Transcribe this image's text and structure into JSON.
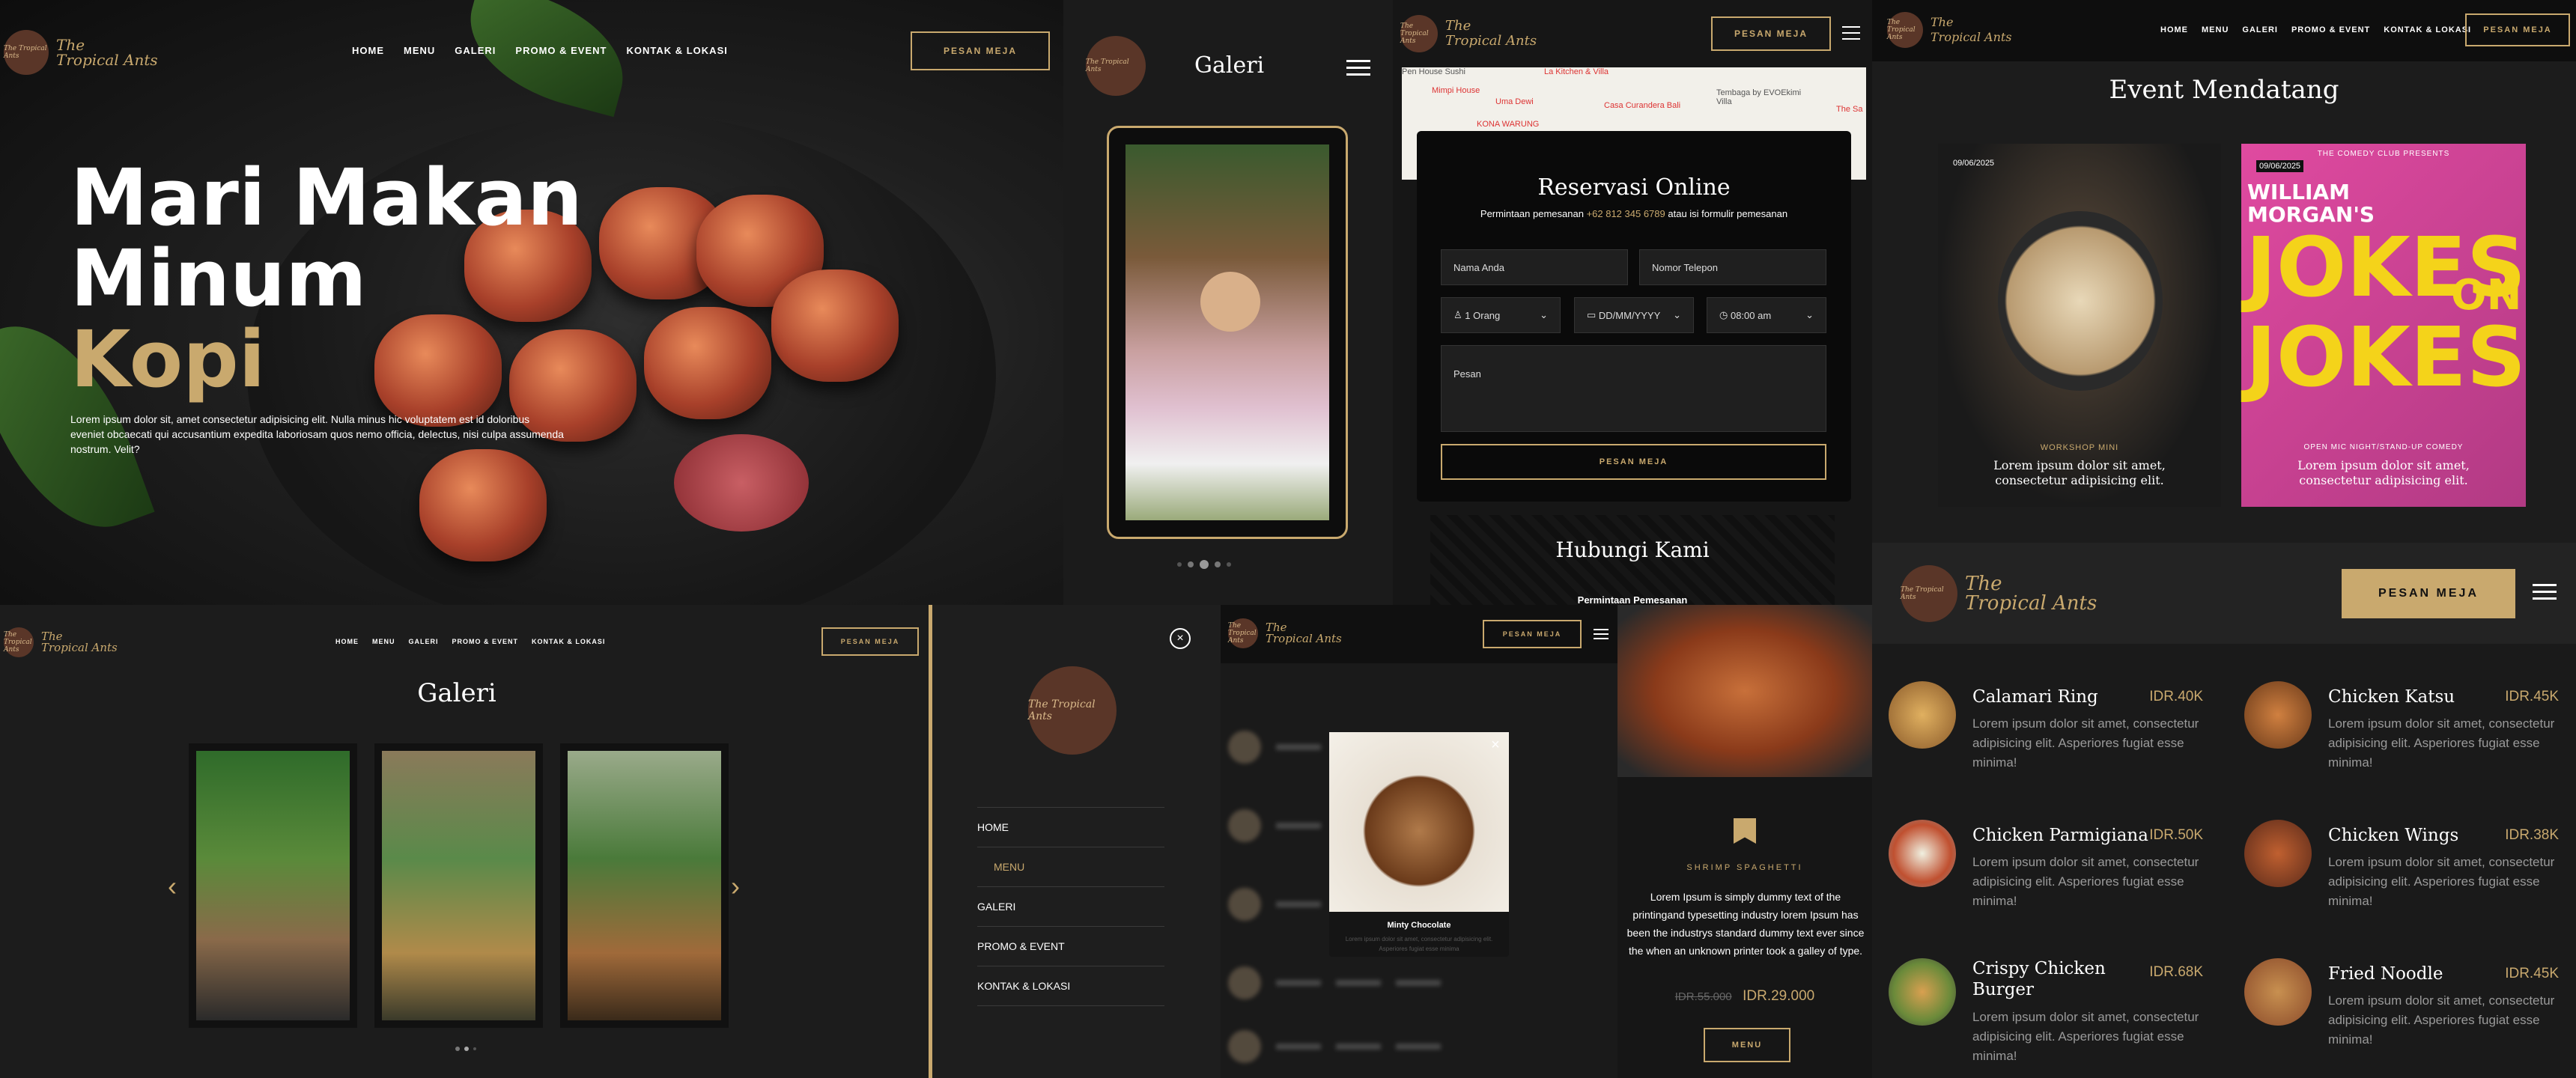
{
  "brand": {
    "logo_badge": "The Tropical Ants",
    "name_line1": "The",
    "name_line2": "Tropical Ants"
  },
  "nav": [
    "HOME",
    "MENU",
    "GALERI",
    "PROMO & EVENT",
    "KONTAK & LOKASI"
  ],
  "cta_label": "PESAN MEJA",
  "hero": {
    "line1": "Mari Makan",
    "line2": "Minum",
    "line3": "Kopi",
    "desc": "Lorem ipsum dolor sit, amet consectetur adipisicing elit. Nulla minus hic voluptatem est id doloribus eveniet obcaecati qui accusantium expedita laboriosam quos nemo officia, delectus, nisi culpa assumenda nostrum. Velit?"
  },
  "gallery_mobile": {
    "title": "Galeri"
  },
  "map_labels": [
    "Pen House Sushi",
    "La Kitchen & Villa",
    "Mimpi House",
    "Uma Dewi",
    "Casa Curandera Bali",
    "Tembaga by EVOEkimi Villa",
    "KONA WARUNG",
    "The Sa"
  ],
  "reservation": {
    "title": "Reservasi Online",
    "subtitle_pre": "Permintaan pemesanan",
    "phone": "+62 812 345 6789",
    "subtitle_post": "atau isi formulir pemesanan",
    "name_ph": "Nama Anda",
    "phone_ph": "Nomor Telepon",
    "people": "1 Orang",
    "date": "DD/MM/YYYY",
    "time": "08:00 am",
    "message_ph": "Pesan",
    "submit": "PESAN MEJA"
  },
  "contact": {
    "title": "Hubungi Kami",
    "sub": "Permintaan Pemesanan"
  },
  "events": {
    "title": "Event Mendatang",
    "items": [
      {
        "date": "09/06/2025",
        "tag": "WORKSHOP MINI",
        "desc": "Lorem ipsum dolor sit amet, consectetur adipisicing elit."
      },
      {
        "date": "09/06/2025",
        "top": "THE COMEDY CLUB PRESENTS",
        "poster1": "WILLIAM",
        "poster2": "MORGAN'S",
        "poster3": "JOKES",
        "poster4": "ON",
        "poster5": "JOKES",
        "tag": "OPEN MIC NIGHT/STAND-UP COMEDY",
        "desc": "Lorem ipsum dolor sit amet, consectetur adipisicing elit."
      }
    ]
  },
  "menu_list": [
    {
      "name": "Calamari Ring",
      "price": "IDR.40K",
      "desc": "Lorem ipsum dolor sit amet, consectetur adipisicing elit. Asperiores fugiat esse minima!"
    },
    {
      "name": "Chicken Katsu",
      "price": "IDR.45K",
      "desc": "Lorem ipsum dolor sit amet, consectetur adipisicing elit. Asperiores fugiat esse minima!"
    },
    {
      "name": "Chicken Parmigiana",
      "price": "IDR.50K",
      "desc": "Lorem ipsum dolor sit amet, consectetur adipisicing elit. Asperiores fugiat esse minima!"
    },
    {
      "name": "Chicken Wings",
      "price": "IDR.38K",
      "desc": "Lorem ipsum dolor sit amet, consectetur adipisicing elit. Asperiores fugiat esse minima!"
    },
    {
      "name": "Crispy Chicken Burger",
      "price": "IDR.68K",
      "desc": "Lorem ipsum dolor sit amet, consectetur adipisicing elit. Asperiores fugiat esse minima!"
    },
    {
      "name": "Fried Noodle",
      "price": "IDR.45K",
      "desc": "Lorem ipsum dolor sit amet, consectetur adipisicing elit. Asperiores fugiat esse minima!"
    }
  ],
  "gallery_desktop": {
    "title": "Galeri"
  },
  "mobile_menu": [
    "HOME",
    "MENU",
    "GALERI",
    "PROMO & EVENT",
    "KONTAK & LOKASI"
  ],
  "popup": {
    "title": "Minty Chocolate",
    "desc1": "Lorem ipsum dolor sit amet, consectetur adipisicing elit.",
    "desc2": "Asperiores fugiat esse minima"
  },
  "dish": {
    "title": "SHRIMP SPAGHETTI",
    "desc": "Lorem Ipsum is simply dummy text of the printingand typesetting industry lorem Ipsum has been the industrys standard dummy text ever since the when an unknown printer took a galley of type.",
    "old_price": "IDR.55.000",
    "price": "IDR.29.000",
    "button": "MENU"
  },
  "colors": {
    "gold": "#c9a96e",
    "bg": "#1b1b1b",
    "pink": "#d6499a",
    "yellow": "#f4d31a"
  }
}
